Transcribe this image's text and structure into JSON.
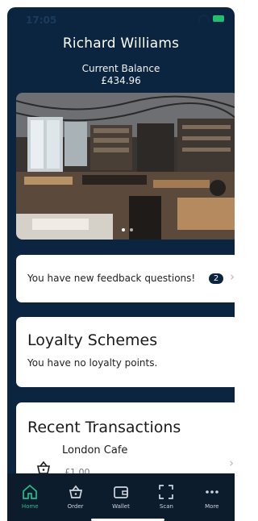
{
  "status_bar": {
    "time": "17:05"
  },
  "user": {
    "name": "Richard Williams"
  },
  "balance": {
    "label": "Current Balance",
    "value": "£434.96"
  },
  "carousel": {
    "total": 2,
    "active": 1
  },
  "feedback": {
    "text": "You have new feedback questions!",
    "count": "2"
  },
  "loyalty": {
    "title": "Loyalty Schemes",
    "subtitle": "You have no loyalty points."
  },
  "transactions": {
    "title": "Recent Transactions",
    "items": [
      {
        "merchant": "London Cafe",
        "amount": "£1.00"
      }
    ]
  },
  "tabs": [
    {
      "label": "Home",
      "icon": "home-icon",
      "active": true
    },
    {
      "label": "Order",
      "icon": "basket-icon",
      "active": false
    },
    {
      "label": "Wallet",
      "icon": "wallet-icon",
      "active": false
    },
    {
      "label": "Scan",
      "icon": "scan-icon",
      "active": false
    },
    {
      "label": "More",
      "icon": "more-icon",
      "active": false
    }
  ],
  "colors": {
    "background": "#0b2540",
    "tab_bar": "#0d1c2d",
    "accent": "#1fbf8a",
    "card": "#ffffff"
  }
}
